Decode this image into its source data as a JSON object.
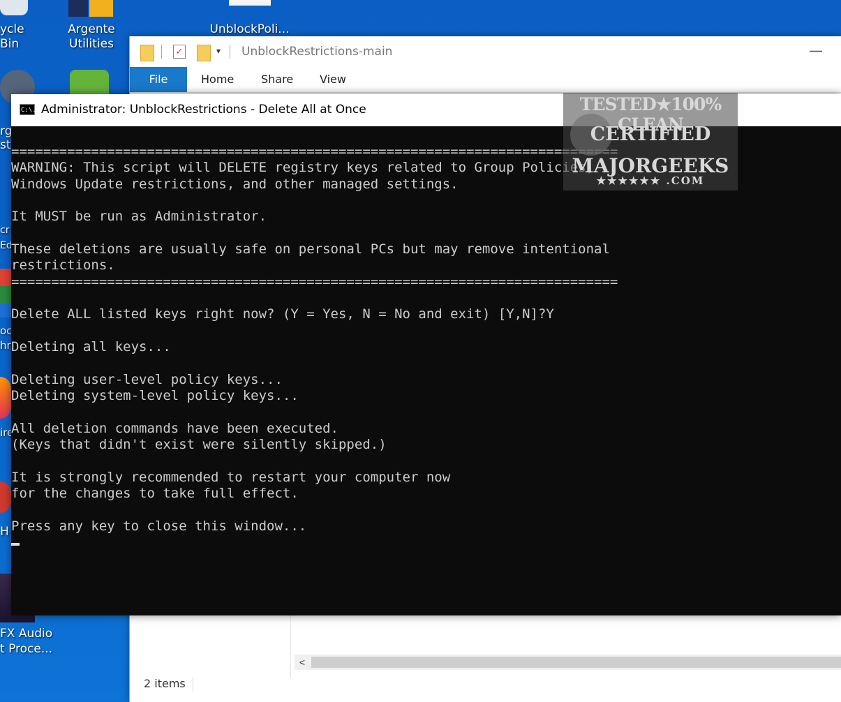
{
  "desktop": {
    "icons": [
      {
        "label": "ycle Bin"
      },
      {
        "label": "Argente Utilities"
      },
      {
        "label": "UnblockPoli..."
      },
      {
        "label": "FX Audio"
      },
      {
        "label": "t Proce..."
      }
    ],
    "partial_labels": [
      "rg",
      "st",
      "cr",
      "Ed",
      "oc",
      "hr",
      "ire",
      "H"
    ]
  },
  "explorer": {
    "title": "UnblockRestrictions-main",
    "minimize_glyph": "—",
    "ribbon_tabs": [
      "File",
      "Home",
      "Share",
      "View"
    ],
    "scroll_left_glyph": "<",
    "status": "2 items"
  },
  "console": {
    "title": "Administrator:  UnblockRestrictions - Delete All at Once",
    "icon_text": "C:\\.",
    "lines": [
      "============================================================================",
      "WARNING: This script will DELETE registry keys related to Group Policies,",
      "Windows Update restrictions, and other managed settings.",
      "",
      "It MUST be run as Administrator.",
      "",
      "These deletions are usually safe on personal PCs but may remove intentional",
      "restrictions.",
      "============================================================================",
      "",
      "Delete ALL listed keys right now? (Y = Yes, N = No and exit) [Y,N]?Y",
      "",
      "Deleting all keys...",
      "",
      "Deleting user-level policy keys...",
      "Deleting system-level policy keys...",
      "",
      "All deletion commands have been executed.",
      "(Keys that didn't exist were silently skipped.)",
      "",
      "It is strongly recommended to restart your computer now",
      "for the changes to take full effect.",
      "",
      "Press any key to close this window..."
    ]
  },
  "watermark": {
    "line1": "TESTED★100% CLEAN",
    "line2": "CERTIFIED",
    "line3": "MAJORGEEKS",
    "line4": "★★★★★★ .COM"
  }
}
